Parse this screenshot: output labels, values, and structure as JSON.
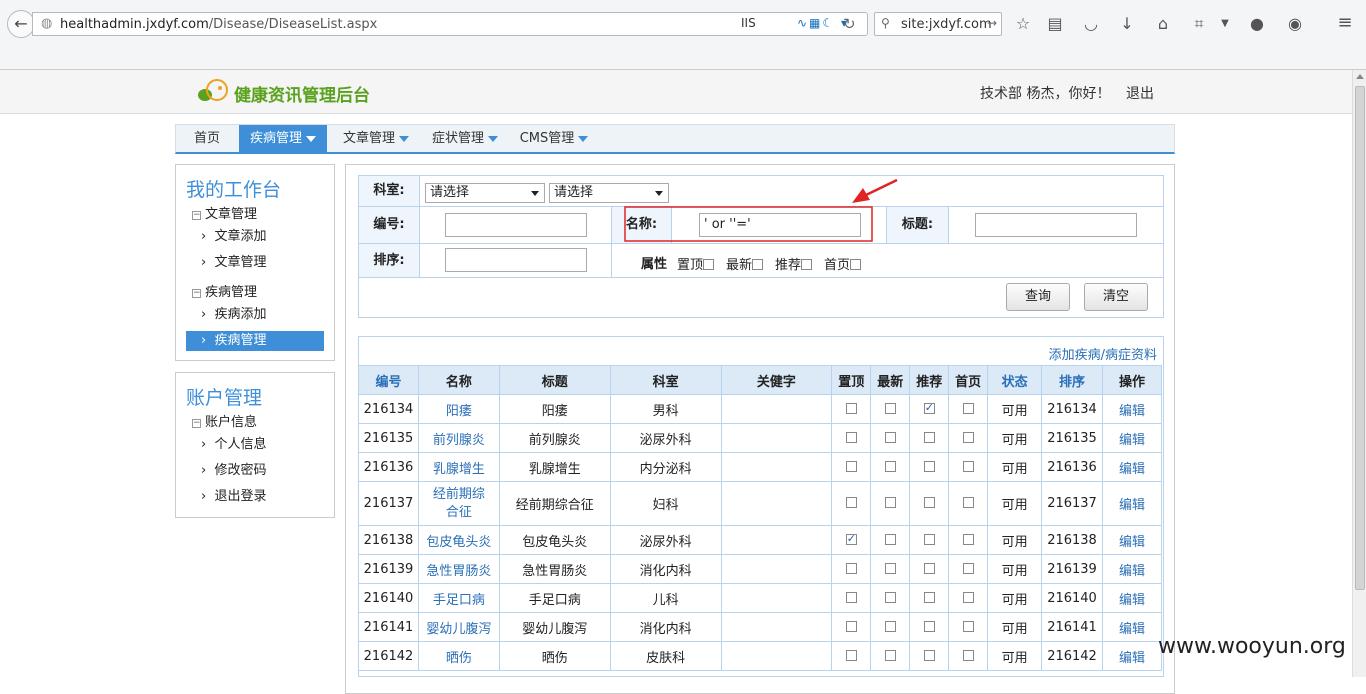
{
  "browser": {
    "url_host": "healthadmin.jxdyf.com",
    "url_path": "/Disease/DiseaseList.aspx",
    "iis_label": "IIS",
    "search_text": "site:jxdyf.com"
  },
  "header": {
    "logo_text": "健康资讯管理后台",
    "welcome_text": "技术部 杨杰，你好！",
    "logout_label": "退出"
  },
  "nav": {
    "home": "首页",
    "disease": "疾病管理",
    "article": "文章管理",
    "symptom": "症状管理",
    "cms": "CMS管理"
  },
  "sidebar": {
    "workbench_title": "我的工作台",
    "article_group": "文章管理",
    "article_add": "文章添加",
    "article_manage": "文章管理",
    "disease_group": "疾病管理",
    "disease_add": "疾病添加",
    "disease_manage": "疾病管理",
    "account_title": "账户管理",
    "account_group": "账户信息",
    "personal_info": "个人信息",
    "change_password": "修改密码",
    "logout": "退出登录"
  },
  "form": {
    "department_label": "科室:",
    "dept_select_1": "请选择",
    "dept_select_2": "请选择",
    "code_label": "编号:",
    "code_value": "",
    "name_label": "名称:",
    "name_value": "' or ''='",
    "title_label": "标题:",
    "title_value": "",
    "sort_label": "排序:",
    "sort_value": "",
    "attr_label": "属性",
    "attr_top": "置顶",
    "attr_new": "最新",
    "attr_recommend": "推荐",
    "attr_home": "首页",
    "query_button": "查询",
    "clear_button": "清空"
  },
  "table": {
    "add_link": "添加疾病/病症资料",
    "headers": [
      "编号",
      "名称",
      "标题",
      "科室",
      "关健字",
      "置顶",
      "最新",
      "推荐",
      "首页",
      "状态",
      "排序",
      "操作"
    ],
    "rows": [
      {
        "id": "216134",
        "name": "阳痿",
        "title": "阳痿",
        "dept": "男科",
        "keyword": "",
        "top": false,
        "latest": false,
        "recommend": true,
        "home": false,
        "status": "可用",
        "sort": "216134",
        "action": "编辑"
      },
      {
        "id": "216135",
        "name": "前列腺炎",
        "title": "前列腺炎",
        "dept": "泌尿外科",
        "keyword": "",
        "top": false,
        "latest": false,
        "recommend": false,
        "home": false,
        "status": "可用",
        "sort": "216135",
        "action": "编辑"
      },
      {
        "id": "216136",
        "name": "乳腺增生",
        "title": "乳腺增生",
        "dept": "内分泌科",
        "keyword": "",
        "top": false,
        "latest": false,
        "recommend": false,
        "home": false,
        "status": "可用",
        "sort": "216136",
        "action": "编辑"
      },
      {
        "id": "216137",
        "name": "经前期综合征",
        "title": "经前期综合征",
        "dept": "妇科",
        "keyword": "",
        "top": false,
        "latest": false,
        "recommend": false,
        "home": false,
        "status": "可用",
        "sort": "216137",
        "action": "编辑"
      },
      {
        "id": "216138",
        "name": "包皮龟头炎",
        "title": "包皮龟头炎",
        "dept": "泌尿外科",
        "keyword": "",
        "top": true,
        "latest": false,
        "recommend": false,
        "home": false,
        "status": "可用",
        "sort": "216138",
        "action": "编辑"
      },
      {
        "id": "216139",
        "name": "急性胃肠炎",
        "title": "急性胃肠炎",
        "dept": "消化内科",
        "keyword": "",
        "top": false,
        "latest": false,
        "recommend": false,
        "home": false,
        "status": "可用",
        "sort": "216139",
        "action": "编辑"
      },
      {
        "id": "216140",
        "name": "手足口病",
        "title": "手足口病",
        "dept": "儿科",
        "keyword": "",
        "top": false,
        "latest": false,
        "recommend": false,
        "home": false,
        "status": "可用",
        "sort": "216140",
        "action": "编辑"
      },
      {
        "id": "216141",
        "name": "婴幼儿腹泻",
        "title": "婴幼儿腹泻",
        "dept": "消化内科",
        "keyword": "",
        "top": false,
        "latest": false,
        "recommend": false,
        "home": false,
        "status": "可用",
        "sort": "216141",
        "action": "编辑"
      },
      {
        "id": "216142",
        "name": "晒伤",
        "title": "晒伤",
        "dept": "皮肤科",
        "keyword": "",
        "top": false,
        "latest": false,
        "recommend": false,
        "home": false,
        "status": "可用",
        "sort": "216142",
        "action": "编辑"
      }
    ]
  },
  "watermark": "www.wooyun.org",
  "annotation": {
    "color": "#e02424"
  }
}
